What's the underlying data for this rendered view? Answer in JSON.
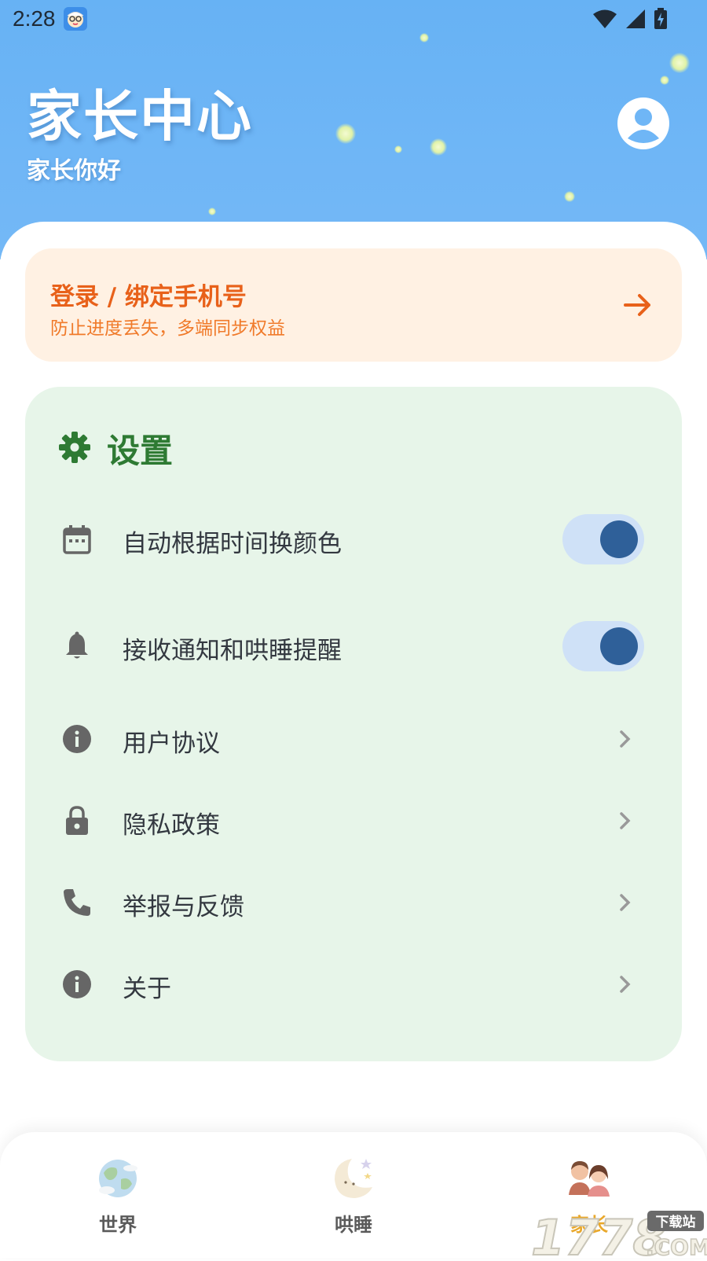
{
  "status_bar": {
    "time": "2:28",
    "icons": [
      "app-notification-icon",
      "wifi-icon",
      "cellular-signal-icon",
      "battery-charging-icon"
    ]
  },
  "header": {
    "title": "家长中心",
    "subtitle": "家长你好",
    "avatar_icon": "account-circle-icon"
  },
  "login_card": {
    "title": "登录 / 绑定手机号",
    "subtitle": "防止进度丢失，多端同步权益",
    "arrow_icon": "arrow-right-icon"
  },
  "settings": {
    "title": "设置",
    "icon": "gear-icon",
    "items": [
      {
        "label": "自动根据时间换颜色",
        "icon": "calendar-icon",
        "control": "toggle",
        "on": true
      },
      {
        "label": "接收通知和哄睡提醒",
        "icon": "bell-icon",
        "control": "toggle",
        "on": true
      },
      {
        "label": "用户协议",
        "icon": "info-icon",
        "control": "chevron"
      },
      {
        "label": "隐私政策",
        "icon": "lock-icon",
        "control": "chevron"
      },
      {
        "label": "举报与反馈",
        "icon": "phone-icon",
        "control": "chevron"
      },
      {
        "label": "关于",
        "icon": "info-icon",
        "control": "chevron"
      }
    ]
  },
  "bottom_nav": {
    "items": [
      {
        "label": "世界",
        "icon": "globe-icon",
        "active": false
      },
      {
        "label": "哄睡",
        "icon": "moon-icon",
        "active": false
      },
      {
        "label": "家长",
        "icon": "parents-icon",
        "active": true
      }
    ]
  },
  "watermark": {
    "brand": "1778",
    "tag": "下载站",
    "suffix": ".COM"
  },
  "colors": {
    "header_blue": "#6fb6f6",
    "login_bg": "#fff1e3",
    "login_accent": "#e8611a",
    "settings_bg": "#e7f5e9",
    "settings_title": "#2e7a33",
    "toggle_track": "#cfe1f7",
    "toggle_knob": "#2f6099",
    "nav_active": "#e9a82c"
  }
}
